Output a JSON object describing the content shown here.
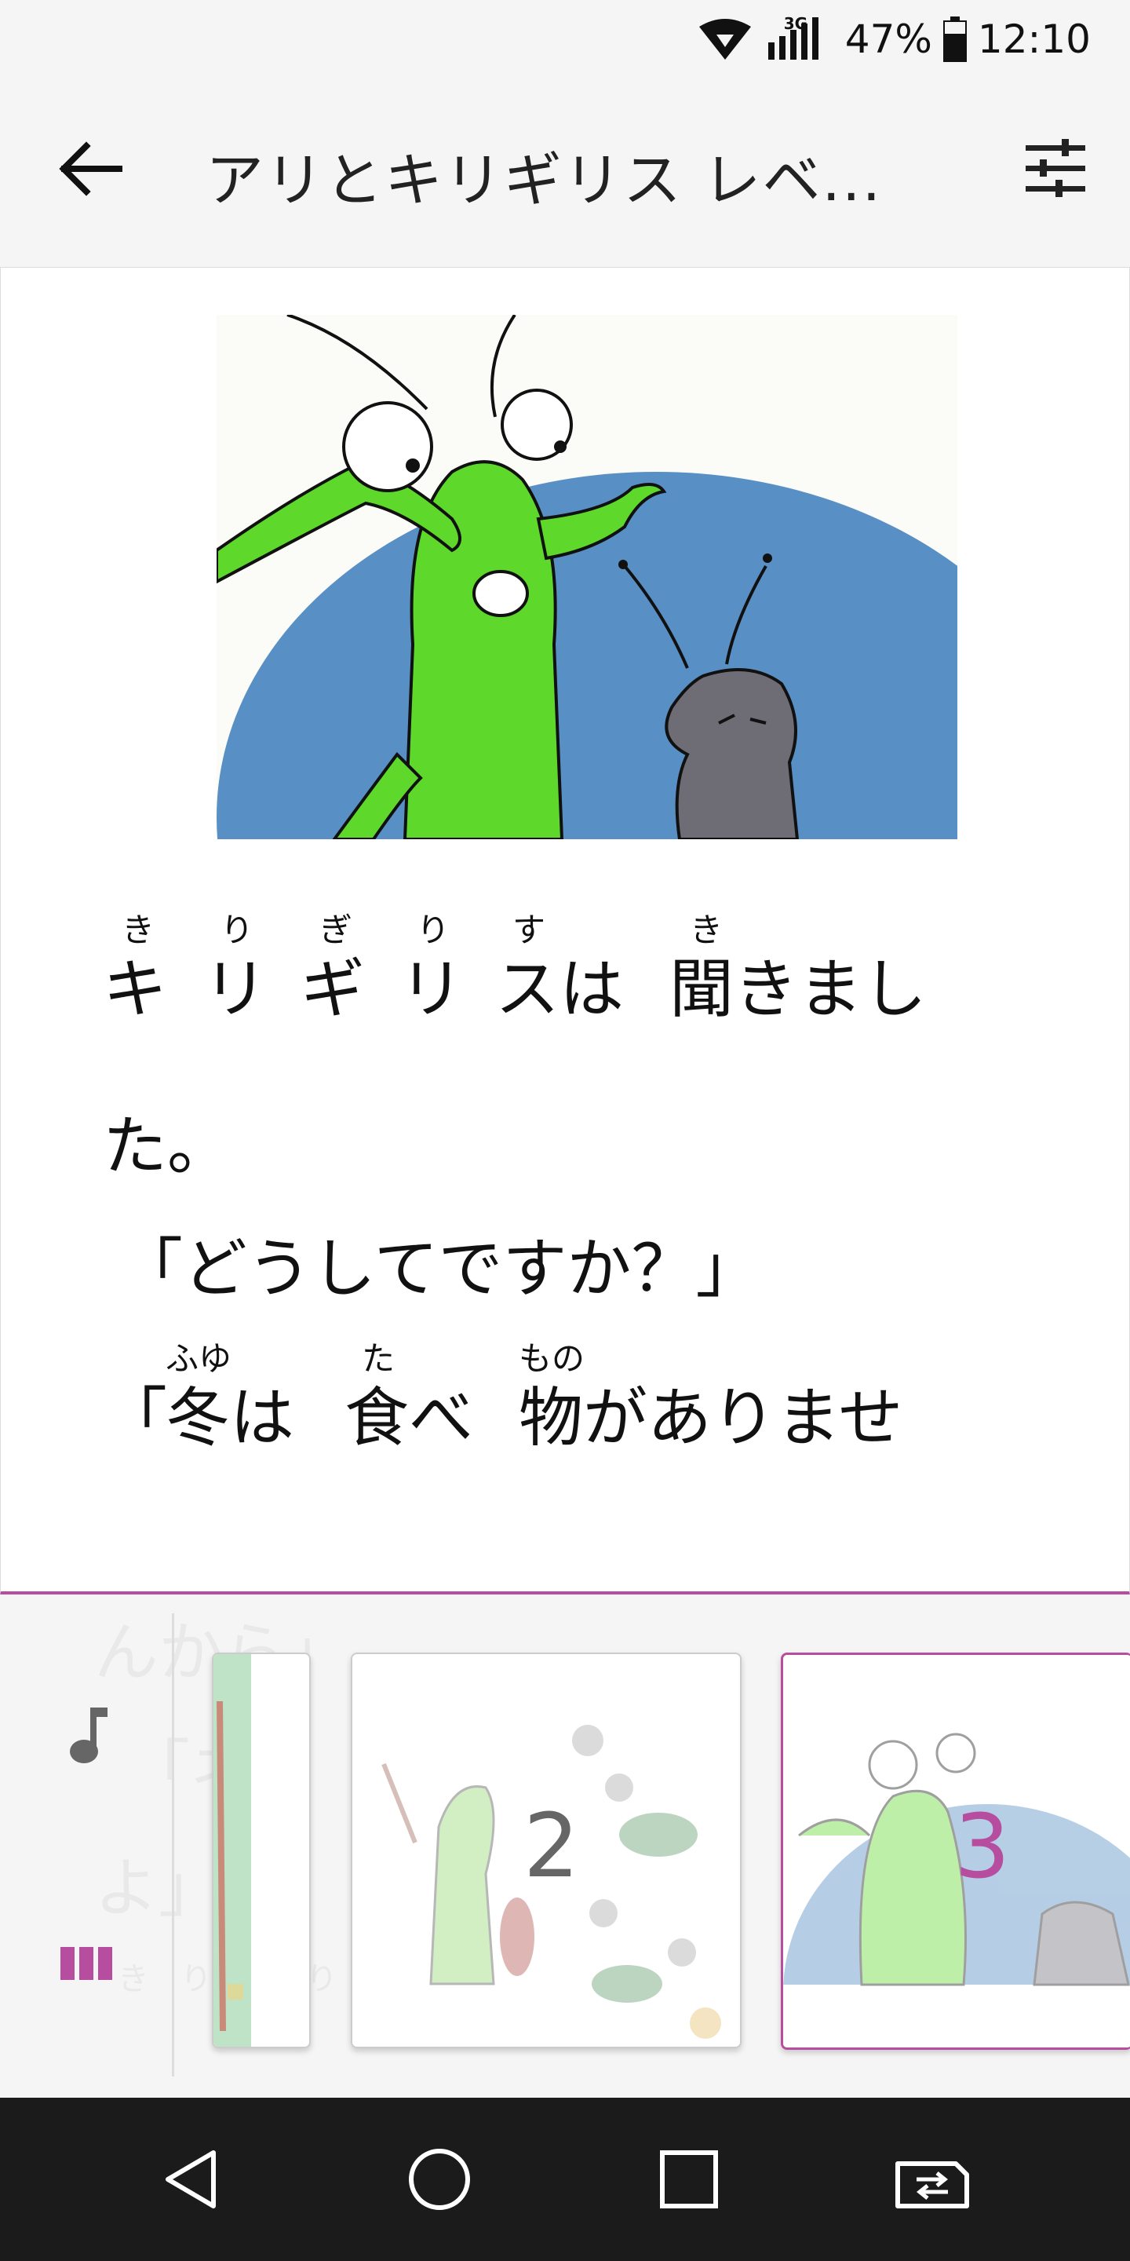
{
  "status_bar": {
    "network_tag": "3G",
    "battery": "47%",
    "time": "12:10"
  },
  "app_bar": {
    "title": "アリとキリギリス レベ..."
  },
  "story": {
    "lines": [
      {
        "rubies": [
          "き",
          "り",
          "ぎ",
          "り",
          "す",
          "き"
        ],
        "text": [
          "キ",
          "リ",
          "ギ",
          "リ",
          "スは",
          "聞きまし"
        ]
      },
      {
        "text": [
          "た。"
        ]
      },
      {
        "text": [
          "「どうしてですか？」"
        ]
      },
      {
        "rubies": [
          "ふゆ",
          "た",
          "もの"
        ],
        "text": [
          "「",
          "冬は",
          "食べ",
          "物がありませ"
        ]
      }
    ]
  },
  "panel": {
    "ghost_lines": [
      "んから」",
      "「ネ",
      "よ」"
    ],
    "ghost_rubies": "き　り　ぎ　り　す　わら",
    "thumbnails": [
      {
        "number": ""
      },
      {
        "number": "2"
      },
      {
        "number": "3",
        "selected": true
      }
    ]
  },
  "colors": {
    "accent": "#b64d9f",
    "grasshopper": "#5ed82a",
    "ant": "#6e6c75",
    "sky": "#4a86bf"
  },
  "icons": [
    "back-arrow-icon",
    "tune-icon",
    "music-note-icon",
    "page-strip-icon",
    "nav-back-icon",
    "nav-home-icon",
    "nav-recents-icon",
    "nav-switch-icon",
    "wifi-icon",
    "signal-icon",
    "battery-icon"
  ]
}
